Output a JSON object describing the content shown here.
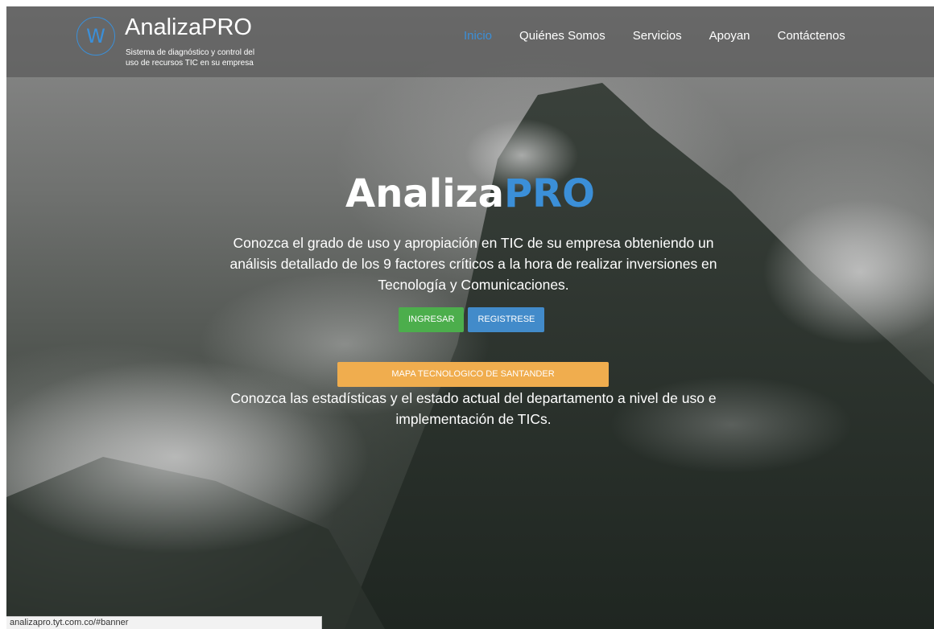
{
  "brand": {
    "logo_letter": "W",
    "name": "AnalizaPRO",
    "tagline_line1": "Sistema de diagnóstico y control del",
    "tagline_line2": "uso de recursos TIC en su empresa"
  },
  "nav": {
    "items": [
      {
        "label": "Inicio",
        "active": true
      },
      {
        "label": "Quiénes Somos",
        "active": false
      },
      {
        "label": "Servicios",
        "active": false
      },
      {
        "label": "Apoyan",
        "active": false
      },
      {
        "label": "Contáctenos",
        "active": false
      }
    ]
  },
  "hero": {
    "title_part1": "Analiza",
    "title_part2": "PRO",
    "description": "Conozca el grado de uso y apropiación en TIC de su empresa obteniendo un análisis detallado de los 9 factores críticos a la hora de realizar inversiones en Tecnología y Comunicaciones.",
    "login_button": "INGRESAR",
    "register_button": "REGISTRESE",
    "map_button": "MAPA TECNOLOGICO DE SANTANDER",
    "map_description": "Conozca las estadísticas y el estado actual del departamento a nivel de uso e implementación de TICs."
  },
  "status_bar": {
    "url": "analizapro.tyt.com.co/#banner"
  },
  "colors": {
    "accent": "#3b8fd8",
    "green": "#4cae4c",
    "blue": "#428bca",
    "orange": "#f0ad4e"
  }
}
